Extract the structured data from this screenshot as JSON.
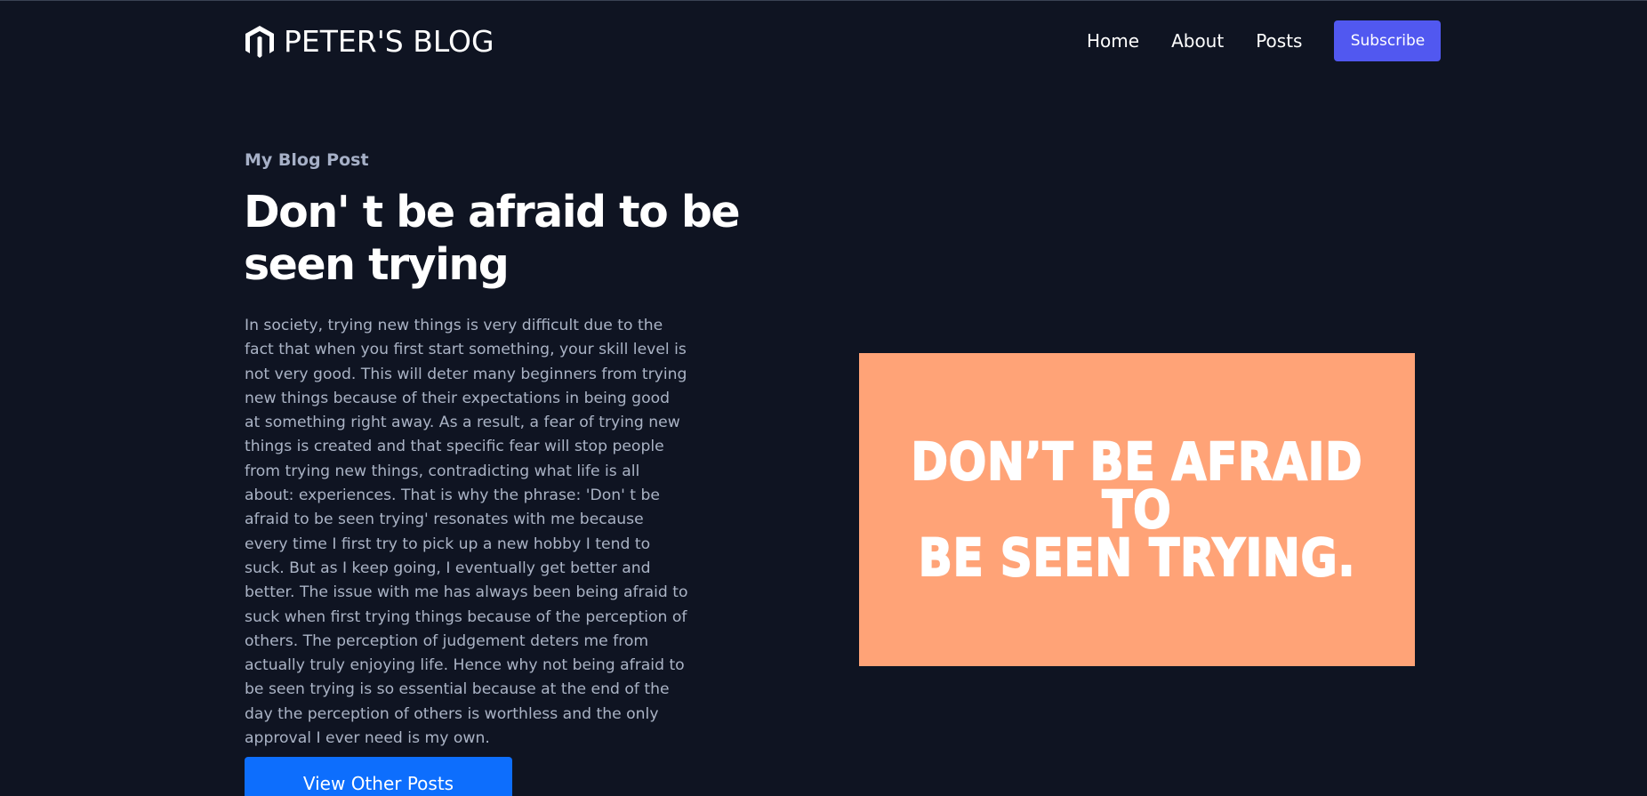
{
  "header": {
    "logo_text": "PETER'S BLOG",
    "logo_icon": "magento-style-m-icon",
    "nav": [
      {
        "label": "Home"
      },
      {
        "label": "About"
      },
      {
        "label": "Posts"
      }
    ],
    "subscribe_label": "Subscribe"
  },
  "post": {
    "eyebrow": "My Blog Post",
    "title": "Don' t be afraid to be seen trying",
    "body": "In society, trying new things is very difficult due to the fact that when you first start something, your skill level is not very good. This will deter many beginners from trying new things because of their expectations in being good at something right away. As a result, a fear of trying new things is created and that specific fear will stop people from trying new things, contradicting what life is all about: experiences. That is why the phrase: 'Don' t be afraid to be seen trying' resonates with me because every time I first try to pick up a new hobby I tend to suck. But as I keep going, I eventually get better and better. The issue with me has always been being afraid to suck when first trying things because of the perception of others. The perception of judgement deters me from actually truly enjoying life. Hence why not being afraid to be seen trying is so essential because at the end of the day the perception of others is worthless and the only approval I ever need is my own.",
    "cta_label": "View Other Posts",
    "image_caption_line1": "DON’T BE AFRAID TO",
    "image_caption_line2": "BE SEEN TRYING."
  },
  "colors": {
    "background": "#0f1422",
    "subscribe_button": "#5158f0",
    "cta_button": "#0d6efd",
    "image_background": "#ffa377",
    "muted_text": "#aab3c5"
  }
}
